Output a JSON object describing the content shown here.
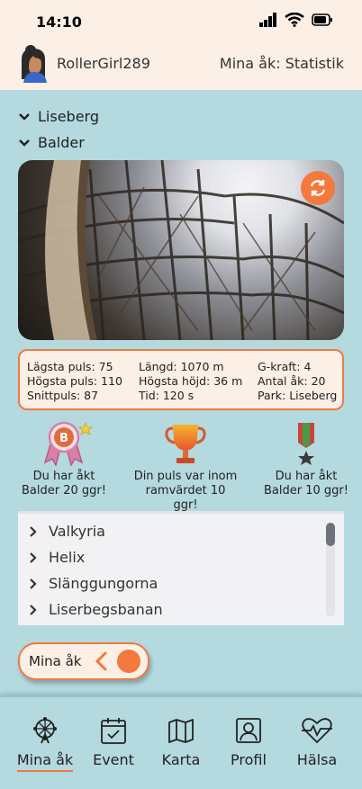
{
  "status_bar": {
    "time": "14:10"
  },
  "header": {
    "username": "RollerGirl289",
    "page_title": "Mina åk: Statistik"
  },
  "tree": {
    "park": "Liseberg",
    "ride": "Balder"
  },
  "stats": {
    "col1": [
      "Lägsta puls: 75",
      "Högsta puls: 110",
      "Snittpuls: 87"
    ],
    "col2": [
      "Längd: 1070 m",
      "Högsta höjd: 36 m",
      "Tid: 120 s"
    ],
    "col3": [
      "G-kraft: 4",
      "Antal åk: 20",
      "Park: Liseberg"
    ]
  },
  "achievements": [
    {
      "line1": "Du har åkt",
      "line2": "Balder 20 ggr!",
      "icon": "ribbon-badge-icon",
      "badge_letter": "B"
    },
    {
      "line1": "Din puls var inom",
      "line2": "ramvärdet 10 ggr!",
      "icon": "trophy-icon"
    },
    {
      "line1": "Du har åkt",
      "line2": "Balder 10 ggr!",
      "icon": "medal-icon"
    }
  ],
  "ride_list": [
    "Valkyria",
    "Helix",
    "Slänggungorna",
    "Liserbegsbanan"
  ],
  "toggle": {
    "label": "Mina åk"
  },
  "tabs": [
    {
      "label": "Mina åk",
      "icon": "ferris-wheel-icon",
      "active": true
    },
    {
      "label": "Event",
      "icon": "calendar-icon",
      "active": false
    },
    {
      "label": "Karta",
      "icon": "map-icon",
      "active": false
    },
    {
      "label": "Profil",
      "icon": "profile-icon",
      "active": false
    },
    {
      "label": "Hälsa",
      "icon": "heart-pulse-icon",
      "active": false
    }
  ],
  "colors": {
    "accent": "#f5783d",
    "background": "#b4d9df",
    "header": "#fcefe6"
  }
}
